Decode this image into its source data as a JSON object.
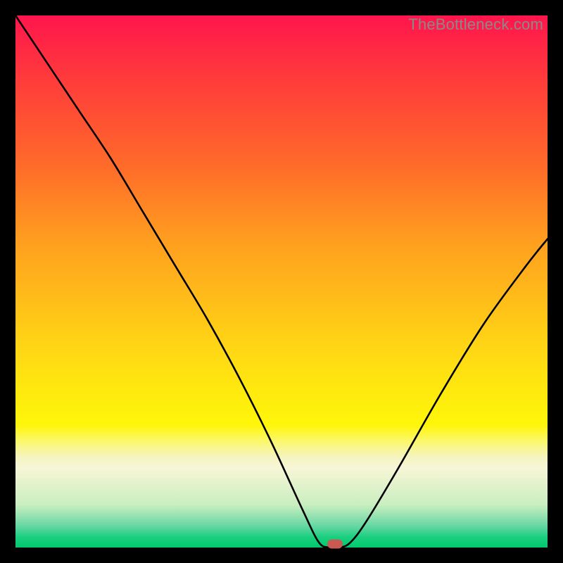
{
  "watermark": "TheBottleneck.com",
  "chart_data": {
    "type": "line",
    "title": "",
    "xlabel": "",
    "ylabel": "",
    "xlim": [
      0,
      100
    ],
    "ylim": [
      0,
      100
    ],
    "series": [
      {
        "name": "bottleneck-curve",
        "x": [
          0,
          6,
          12,
          18,
          24,
          30,
          36,
          42,
          48,
          54,
          57,
          59,
          61,
          63,
          66,
          72,
          80,
          88,
          96,
          100
        ],
        "values": [
          100,
          91,
          82,
          73,
          63,
          53,
          43,
          32,
          20,
          7,
          1,
          0,
          0,
          1,
          5,
          15,
          29,
          42,
          53,
          58
        ]
      }
    ],
    "minimum_marker": {
      "x": 60,
      "y": 0
    },
    "background_gradient": {
      "stops": [
        {
          "pos": 0,
          "color": "#ff154d"
        },
        {
          "pos": 0.28,
          "color": "#ff6a2a"
        },
        {
          "pos": 0.62,
          "color": "#ffd515"
        },
        {
          "pos": 0.83,
          "color": "#f4f4c0"
        },
        {
          "pos": 1.0,
          "color": "#00c96c"
        }
      ]
    }
  }
}
